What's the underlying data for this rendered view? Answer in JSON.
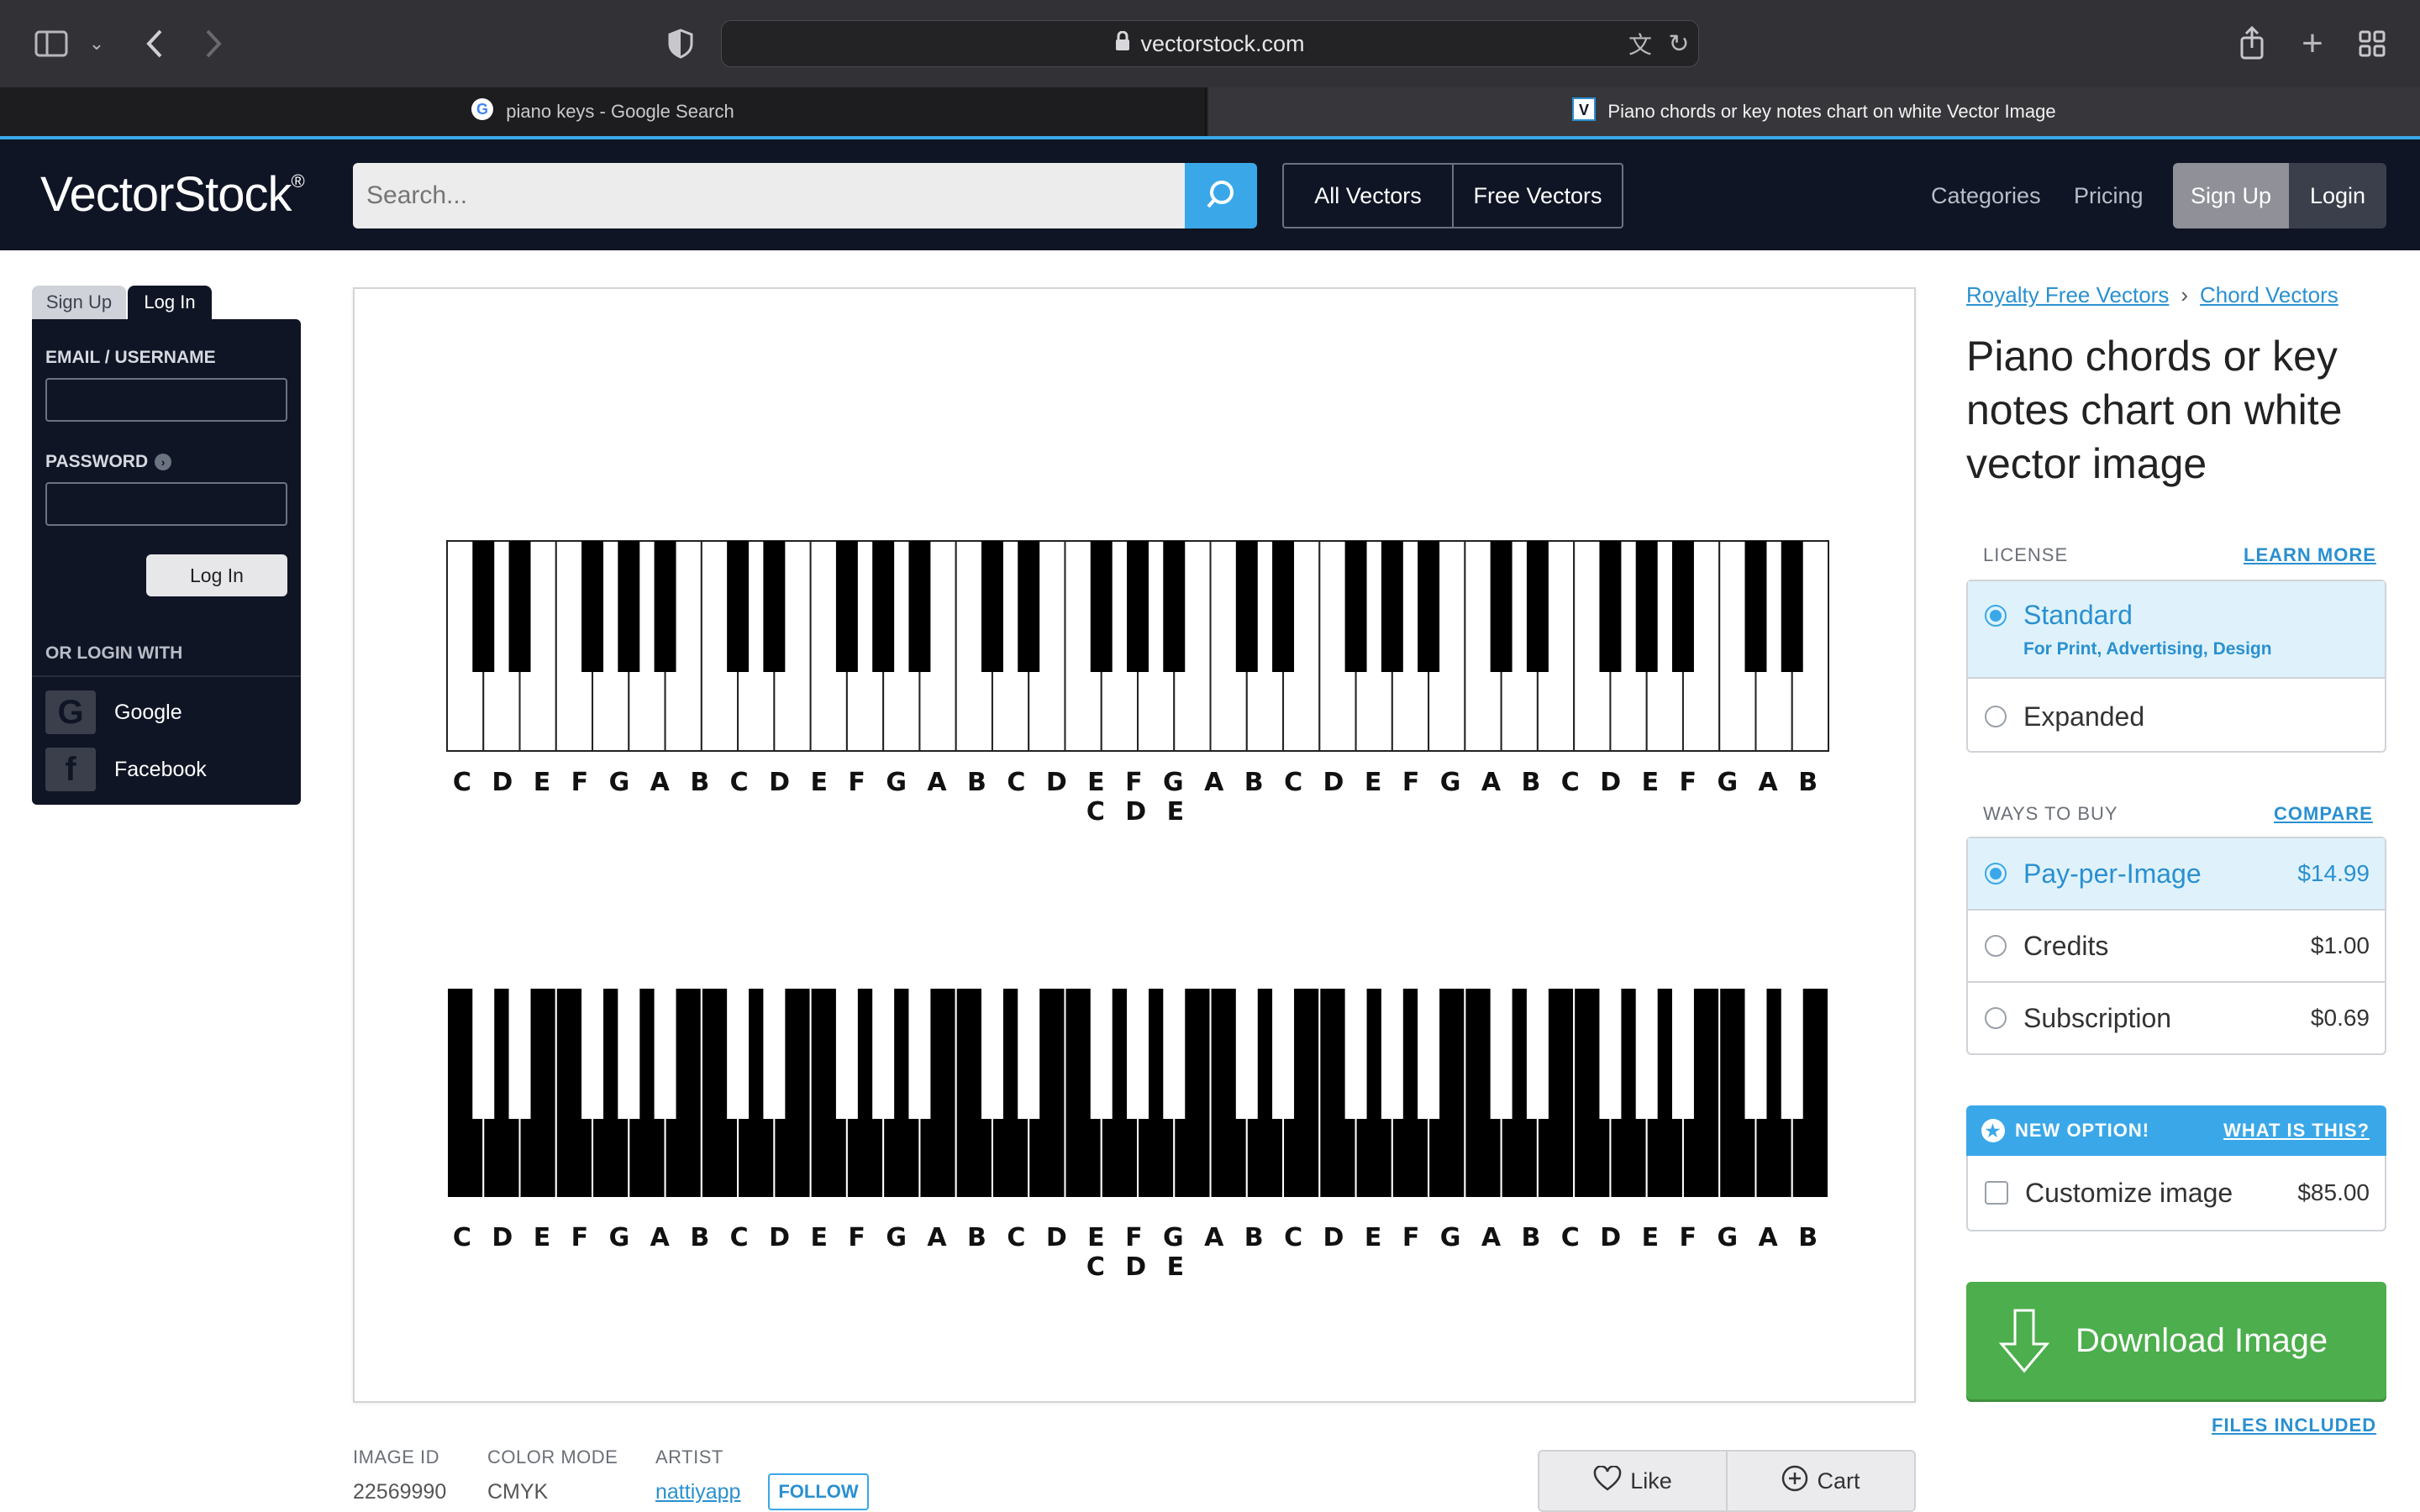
{
  "browser": {
    "address": "vectorstock.com",
    "tabs": [
      {
        "label": "piano keys - Google Search",
        "favicon": "google-icon"
      },
      {
        "label": "Piano chords or key notes chart on white Vector Image",
        "favicon": "vectorstock-icon"
      }
    ]
  },
  "header": {
    "logo_light": "Vector",
    "logo_bold": "Stock",
    "logo_mark": "®",
    "search_placeholder": "Search...",
    "all_vectors": "All Vectors",
    "free_vectors": "Free Vectors",
    "categories": "Categories",
    "pricing": "Pricing",
    "signup": "Sign Up",
    "login": "Login"
  },
  "login_panel": {
    "tab_signup": "Sign Up",
    "tab_login": "Log In",
    "email_label": "EMAIL / USERNAME",
    "password_label": "PASSWORD",
    "submit": "Log In",
    "or_login_with": "OR LOGIN WITH",
    "google": "Google",
    "facebook": "Facebook"
  },
  "image": {
    "notes_top": "C D E F G A B C D E F G A B C D E F G A B C D E F G A B C D E F G A B C D E",
    "notes_bottom": "C D E F G A B C D E F G A B C D E F G A B C D E F G A B C D E F G A B C D E"
  },
  "meta": {
    "image_id_label": "IMAGE ID",
    "image_id": "22569990",
    "color_mode_label": "COLOR MODE",
    "color_mode": "CMYK",
    "artist_label": "ARTIST",
    "artist": "nattiyapp",
    "follow": "FOLLOW",
    "like": "Like",
    "cart": "Cart"
  },
  "product": {
    "breadcrumb": [
      "Royalty Free Vectors",
      "Chord Vectors"
    ],
    "breadcrumb_sep": "›",
    "title": "Piano chords or key notes chart on white vector image",
    "license_label": "LICENSE",
    "learn_more": "LEARN MORE",
    "licenses": [
      {
        "name": "Standard",
        "desc": "For Print, Advertising, Design",
        "selected": true
      },
      {
        "name": "Expanded",
        "desc": "",
        "selected": false
      }
    ],
    "ways_label": "WAYS TO BUY",
    "compare": "COMPARE",
    "ways": [
      {
        "name": "Pay-per-Image",
        "price": "$14.99",
        "selected": true
      },
      {
        "name": "Credits",
        "price": "$1.00",
        "selected": false
      },
      {
        "name": "Subscription",
        "price": "$0.69",
        "selected": false
      }
    ],
    "new_option": "NEW OPTION!",
    "what_is_this": "WHAT IS THIS?",
    "customize": "Customize image",
    "customize_price": "$85.00",
    "download": "Download Image",
    "files_included": "FILES INCLUDED"
  },
  "colors": {
    "accent": "#3aa8e8",
    "header_bg": "#0f1525",
    "download_green": "#4cae4c"
  }
}
